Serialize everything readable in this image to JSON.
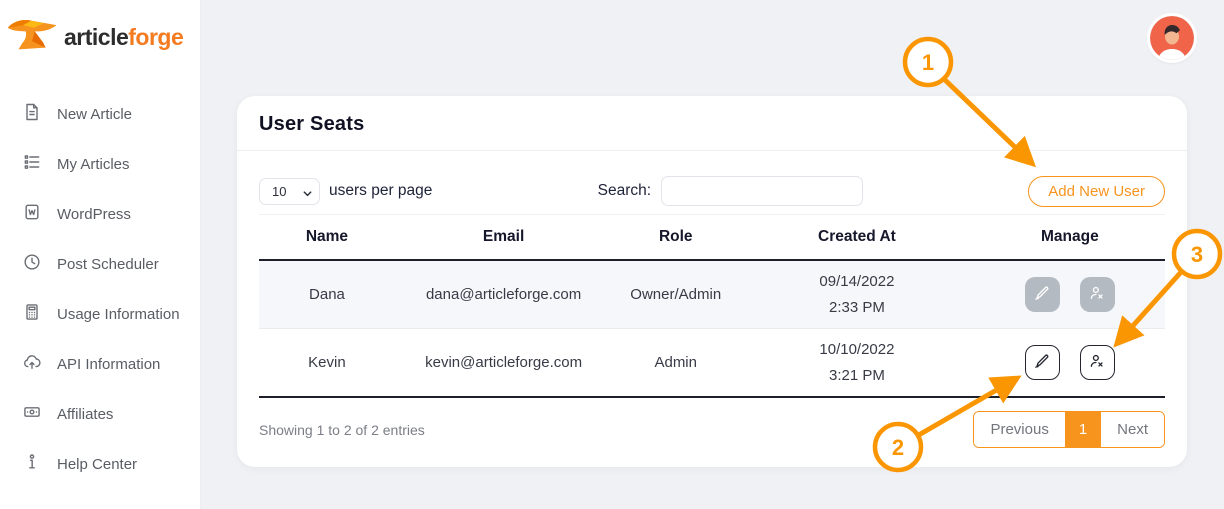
{
  "brand": {
    "logo_text_dark": "article",
    "logo_text_accent": "forge"
  },
  "sidebar": {
    "items": [
      {
        "label": "New Article",
        "icon": "new-article-icon"
      },
      {
        "label": "My Articles",
        "icon": "my-articles-icon"
      },
      {
        "label": "WordPress",
        "icon": "wordpress-icon"
      },
      {
        "label": "Post Scheduler",
        "icon": "post-scheduler-icon"
      },
      {
        "label": "Usage Information",
        "icon": "usage-information-icon"
      },
      {
        "label": "API Information",
        "icon": "api-information-icon"
      },
      {
        "label": "Affiliates",
        "icon": "affiliates-icon"
      },
      {
        "label": "Help Center",
        "icon": "help-center-icon"
      }
    ]
  },
  "card": {
    "title": "User Seats",
    "controls": {
      "page_size_selected": "10",
      "page_size_suffix": "users per page",
      "search_label": "Search:",
      "search_value": "",
      "add_user_button": "Add New User"
    },
    "table": {
      "columns": [
        "Name",
        "Email",
        "Role",
        "Created At",
        "Manage"
      ],
      "rows": [
        {
          "name": "Dana",
          "email": "dana@articleforge.com",
          "role": "Owner/Admin",
          "created_date": "09/14/2022",
          "created_time": "2:33 PM",
          "actions_enabled": false
        },
        {
          "name": "Kevin",
          "email": "kevin@articleforge.com",
          "role": "Admin",
          "created_date": "10/10/2022",
          "created_time": "3:21 PM",
          "actions_enabled": true
        }
      ]
    },
    "footer": {
      "showing_text": "Showing 1 to 2 of 2 entries",
      "pagination": {
        "previous_label": "Previous",
        "current_page": "1",
        "next_label": "Next"
      }
    }
  },
  "annotations": {
    "step1": "1",
    "step2": "2",
    "step3": "3"
  },
  "colors": {
    "accent_orange": "#f7941e",
    "annotation_orange": "#fb9603",
    "logo_orange": "#f47b20",
    "avatar_bg": "#f0644a",
    "row_stripe": "#f6f7fa",
    "dark_text": "#15182b",
    "disabled_button": "#b4bac2"
  }
}
